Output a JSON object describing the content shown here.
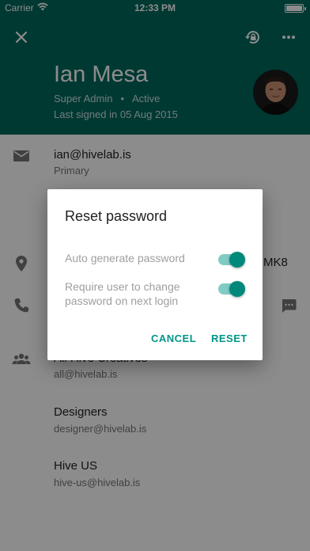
{
  "status_bar": {
    "carrier": "Carrier",
    "time": "12:33 PM"
  },
  "header": {
    "name": "Ian Mesa",
    "role": "Super Admin",
    "status": "Active",
    "last_signed": "Last signed in 05 Aug 2015",
    "bg_color": "#00695c"
  },
  "details": {
    "email": {
      "value": "ian@hivelab.is",
      "type": "Primary"
    },
    "address_fragment": "MK8"
  },
  "groups": [
    {
      "name": "All Hive Creatives",
      "email": "all@hivelab.is"
    },
    {
      "name": "Designers",
      "email": "designer@hivelab.is"
    },
    {
      "name": "Hive US",
      "email": "hive-us@hivelab.is"
    }
  ],
  "dialog": {
    "title": "Reset password",
    "option_auto": "Auto generate password",
    "option_require_line1": "Require user to change",
    "option_require_line2": "password on next login",
    "auto_enabled": true,
    "require_enabled": true,
    "cancel_label": "CANCEL",
    "reset_label": "RESET",
    "accent_color": "#009688"
  }
}
